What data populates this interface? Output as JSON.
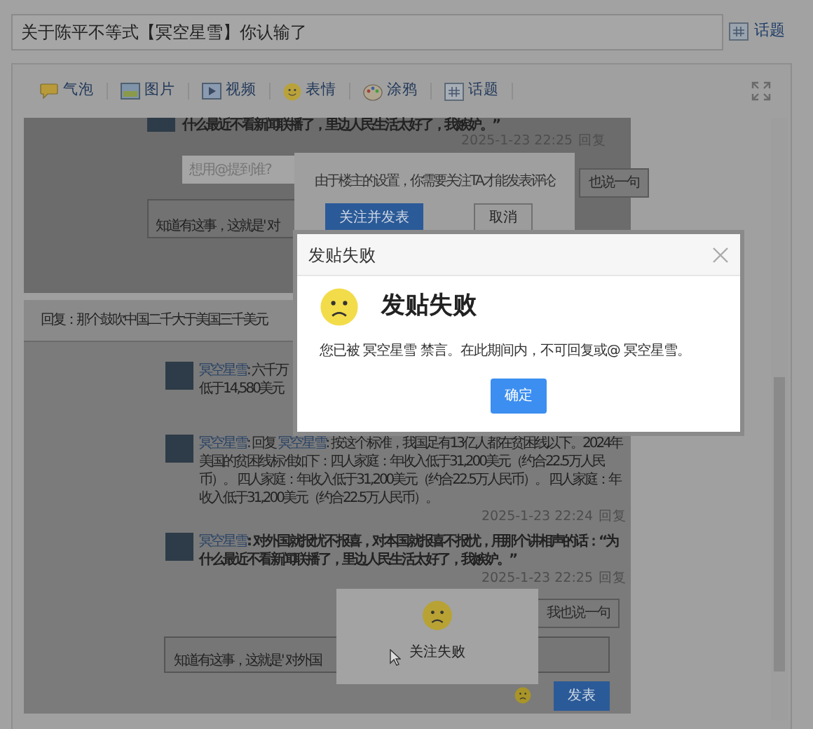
{
  "title_field": {
    "value": "关于陈平不等式【冥空星雪】你认输了"
  },
  "topic_link": {
    "label": "话题"
  },
  "toolbar": {
    "items": [
      {
        "label": "气泡",
        "kind": "bubble"
      },
      {
        "label": "图片",
        "kind": "image"
      },
      {
        "label": "视频",
        "kind": "video"
      },
      {
        "label": "表情",
        "kind": "emoji"
      },
      {
        "label": "涂鸦",
        "kind": "paint"
      },
      {
        "label": "话题",
        "kind": "topic"
      }
    ]
  },
  "embedded_1": {
    "comment_tail": "什么最近不看新闻联播了，里边人民生活太好了，我嫉妒。”",
    "date": "2025-1-23 22:25",
    "reply": "回复",
    "mention_placeholder": "想用@提到谁?",
    "say_button": "也说一句",
    "reply_text": "知道有这事，这就是' 对",
    "follow_popup": {
      "message": "由于楼主的设置，你需要关注TA才能发表评论",
      "buttons": [
        "关注并发表",
        "取消"
      ]
    }
  },
  "embedded_2": {
    "heading": "回复：那个鼓吹中国二千大于美国三千美元",
    "comments": [
      {
        "author": "冥空星雪",
        "separator": ":",
        "text": "六千万",
        "text_2": "低于14,580美元",
        "bold": false
      },
      {
        "author": "冥空星雪",
        "separator": ":",
        "reply_label": "回复",
        "reply_to": "冥空星雪",
        "reply_separator": ":",
        "text": "按这个标准，我国足有13亿人都在贫困线以下。2024年美国的贫困线标准如下：四人家庭：年收入低于31,200美元（约合22.5万人民币）。 四人家庭：年收入低于31,200美元（约合22.5万人民币）。 四人家庭：年收入低于31,200美元（约合22.5万人民币）。",
        "bold": false,
        "date": "2025-1-23 22:24",
        "reply": "回复"
      },
      {
        "author": "冥空星雪",
        "separator": ":",
        "text": "对外国就报忧不报喜，对本国就报喜不报忧，用那个讲相声的话：“为什么最近不看新闻联播了，里边人民生活太好了，我嫉妒。”",
        "bold": true,
        "date": "2025-1-23 22:25",
        "reply": "回复"
      }
    ],
    "say_button": "我也说一句",
    "reply_text": "知道有这事，这就是' 对外国",
    "submit": "发表",
    "toast": {
      "message": "关注失败"
    }
  },
  "dialog": {
    "title": "发贴失败",
    "heading": "发贴失败",
    "message": "您已被 冥空星雪 禁言。在此期间内，不可回复或@ 冥空星雪。",
    "button": "确定"
  }
}
